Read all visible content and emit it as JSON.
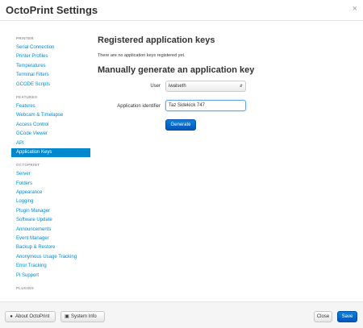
{
  "header": {
    "title": "OctoPrint Settings",
    "close_icon": "×"
  },
  "sidebar": {
    "printer_header": "PRINTER",
    "printer_items": [
      "Serial Connection",
      "Printer Profiles",
      "Temperatures",
      "Terminal Filters",
      "GCODE Scripts"
    ],
    "features_header": "FEATURES",
    "features_items": [
      "Features",
      "Webcam & Timelapse",
      "Access Control",
      "GCode Viewer",
      "API",
      "Application Keys"
    ],
    "octoprint_header": "OCTOPRINT",
    "octoprint_items": [
      "Server",
      "Folders",
      "Appearance",
      "Logging",
      "Plugin Manager",
      "Software Update",
      "Announcements",
      "Event Manager",
      "Backup & Restore",
      "Anonymous Usage Tracking",
      "Error Tracking",
      "Pi Support"
    ],
    "plugins_header": "PLUGINS",
    "active_item": "Application Keys"
  },
  "main": {
    "registered_title": "Registered application keys",
    "no_keys_text": "There are no application keys registered yet.",
    "generate_title": "Manually generate an application key",
    "user_label": "User",
    "user_value": "iwalseth",
    "app_id_label": "Application identifier",
    "app_id_value": "Taz Sidekick 747",
    "generate_button": "Generate"
  },
  "footer": {
    "about_label": "About OctoPrint",
    "sysinfo_label": "System Info",
    "close_label": "Close",
    "save_label": "Save"
  },
  "colors": {
    "accent": "#0088cc",
    "primary_button": "#0a6fd0"
  }
}
